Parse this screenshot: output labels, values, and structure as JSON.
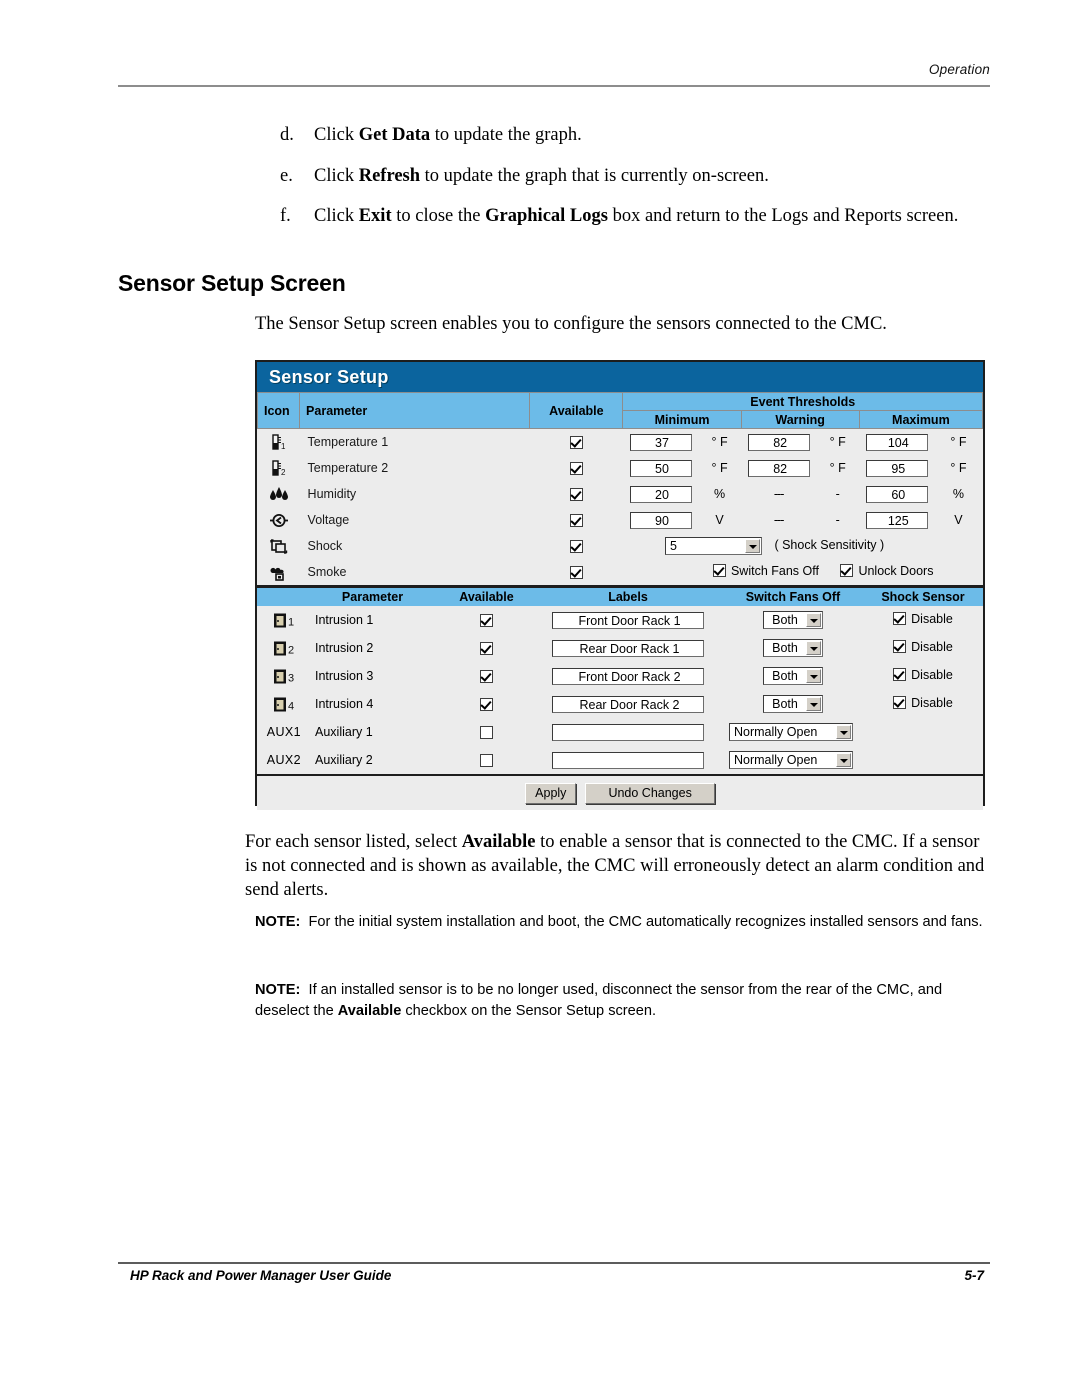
{
  "running_head": "Operation",
  "steps": [
    {
      "marker": "d.",
      "html": "Click <b>Get Data</b> to update the graph."
    },
    {
      "marker": "e.",
      "html": "Click <b>Refresh</b> to update the graph that is currently on-screen."
    },
    {
      "marker": "f.",
      "html": "Click <b>Exit</b> to close the <b>Graphical Logs</b> box and return to the Logs and Reports screen."
    }
  ],
  "section_heading": "Sensor Setup Screen",
  "intro_paragraph": "The Sensor Setup screen enables you to configure the sensors connected to the CMC.",
  "after_paragraph": "For each sensor listed, select <b>Available</b> to enable a sensor that is connected to the CMC. If a sensor is not connected and is shown as available, the CMC will erroneously detect an alarm condition and send alerts.",
  "notes": [
    "<b>NOTE:</b>&nbsp; For the initial system installation and boot, the CMC automatically recognizes installed sensors and fans.",
    "<b>NOTE:</b>&nbsp; If an installed sensor is to be no longer used, disconnect the sensor from the rear of the CMC, and deselect the <b>Available</b> checkbox on the Sensor Setup screen."
  ],
  "footer": {
    "left": "HP Rack and Power Manager User Guide",
    "right": "5-7"
  },
  "colors": {
    "title_bar": "#0b649e",
    "header_row": "#6cbbe8",
    "body_row": "#ececec",
    "frame": "#1d1d1d"
  },
  "screen": {
    "title": "Sensor Setup",
    "table1": {
      "headers": {
        "icon": "Icon",
        "parameter": "Parameter",
        "available": "Available",
        "event_thresholds": "Event Thresholds",
        "minimum": "Minimum",
        "warning": "Warning",
        "maximum": "Maximum"
      },
      "rows": [
        {
          "icon": "thermometer-icon",
          "icon_sub": "1",
          "parameter": "Temperature 1",
          "available": true,
          "minimum": "37",
          "minimum_unit": "° F",
          "warning": "82",
          "warning_unit": "° F",
          "maximum": "104",
          "maximum_unit": "° F"
        },
        {
          "icon": "thermometer-icon",
          "icon_sub": "2",
          "parameter": "Temperature 2",
          "available": true,
          "minimum": "50",
          "minimum_unit": "° F",
          "warning": "82",
          "warning_unit": "° F",
          "maximum": "95",
          "maximum_unit": "° F"
        },
        {
          "icon": "humidity-icon",
          "icon_sub": "",
          "parameter": "Humidity",
          "available": true,
          "minimum": "20",
          "minimum_unit": "%",
          "warning": "---",
          "warning_unit": "-",
          "maximum": "60",
          "maximum_unit": "%"
        },
        {
          "icon": "voltage-icon",
          "icon_sub": "",
          "parameter": "Voltage",
          "available": true,
          "minimum": "90",
          "minimum_unit": "V",
          "warning": "---",
          "warning_unit": "-",
          "maximum": "125",
          "maximum_unit": "V"
        }
      ],
      "shock_row": {
        "icon": "shock-icon",
        "parameter": "Shock",
        "available": true,
        "sensitivity_value": "5",
        "sensitivity_caption": "( Shock Sensitivity )"
      },
      "smoke_row": {
        "icon": "smoke-icon",
        "parameter": "Smoke",
        "available": true,
        "switch_fans_off_label": "Switch Fans Off",
        "switch_fans_off": true,
        "unlock_doors_label": "Unlock Doors",
        "unlock_doors": true
      }
    },
    "table2": {
      "headers": {
        "parameter": "Parameter",
        "available": "Available",
        "labels": "Labels",
        "switch_fans_off": "Switch Fans Off",
        "shock_sensor": "Shock Sensor"
      },
      "rows": [
        {
          "icon": "door-icon",
          "icon_num": "1",
          "parameter": "Intrusion 1",
          "available": true,
          "label_value": "Front Door Rack 1",
          "fans_option": "Both",
          "shock_disable": true,
          "shock_disable_label": "Disable"
        },
        {
          "icon": "door-icon",
          "icon_num": "2",
          "parameter": "Intrusion 2",
          "available": true,
          "label_value": "Rear Door Rack 1",
          "fans_option": "Both",
          "shock_disable": true,
          "shock_disable_label": "Disable"
        },
        {
          "icon": "door-icon",
          "icon_num": "3",
          "parameter": "Intrusion 3",
          "available": true,
          "label_value": "Front Door Rack 2",
          "fans_option": "Both",
          "shock_disable": true,
          "shock_disable_label": "Disable"
        },
        {
          "icon": "door-icon",
          "icon_num": "4",
          "parameter": "Intrusion 4",
          "available": true,
          "label_value": "Rear Door Rack 2",
          "fans_option": "Both",
          "shock_disable": true,
          "shock_disable_label": "Disable"
        },
        {
          "icon": "aux-text",
          "icon_num": "AUX1",
          "parameter": "Auxiliary 1",
          "available": false,
          "label_value": "",
          "fans_option": "Normally Open",
          "shock_disable": null,
          "shock_disable_label": ""
        },
        {
          "icon": "aux-text",
          "icon_num": "AUX2",
          "parameter": "Auxiliary 2",
          "available": false,
          "label_value": "",
          "fans_option": "Normally Open",
          "shock_disable": null,
          "shock_disable_label": ""
        }
      ]
    },
    "buttons": {
      "apply": "Apply",
      "undo": "Undo Changes"
    }
  }
}
